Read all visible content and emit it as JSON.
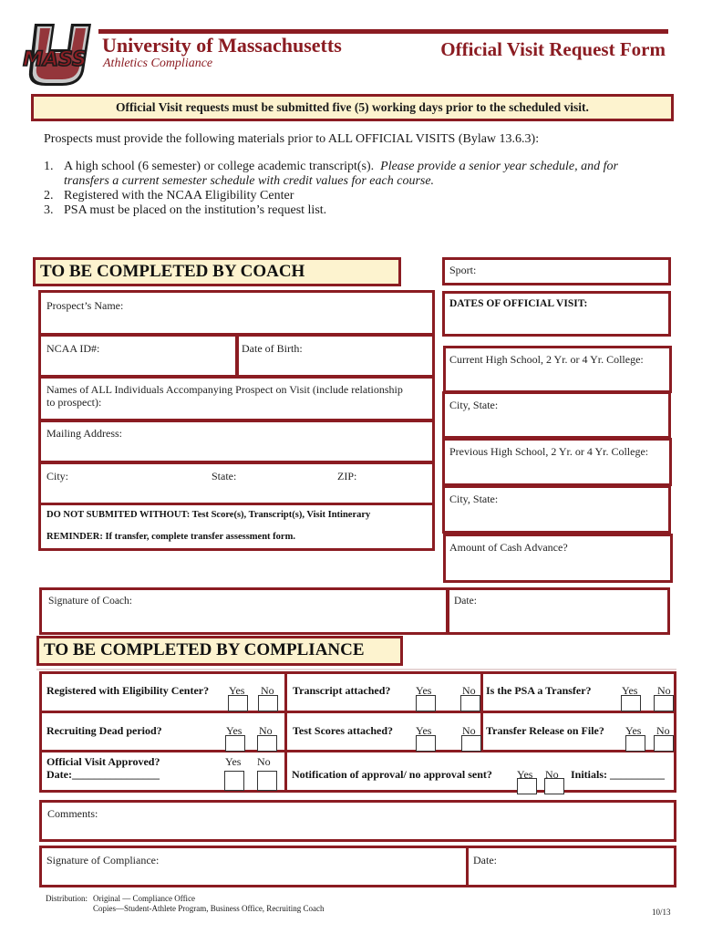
{
  "header": {
    "logo_text": "MASS",
    "logo_letter": "U",
    "university": "University of Massachusetts",
    "department": "Athletics Compliance",
    "form_title": "Official Visit Request Form"
  },
  "notice": "Official Visit requests must be submitted five (5) working days prior to the scheduled visit.",
  "requirements": {
    "intro": "Prospects must provide the following materials prior to ALL OFFICIAL VISITS (Bylaw 13.6.3):",
    "items": [
      {
        "num": "1.",
        "text": "A high school (6 semester) or college academic transcript(s).",
        "italic": "Please provide a senior year schedule, and for",
        "italic2": "transfers a current semester schedule with credit values for each course."
      },
      {
        "num": "2.",
        "text": "Registered with the NCAA Eligibility Center"
      },
      {
        "num": "3.",
        "text": "PSA must be placed on the institution’s request list."
      }
    ]
  },
  "coach_section": {
    "heading": "TO BE COMPLETED BY COACH",
    "fields": {
      "sport": "Sport:",
      "dates_of_visit": "DATES OF OFFICIAL VISIT:",
      "prospect_name": "Prospect’s Name:",
      "ncaa_id": "NCAA ID#:",
      "date_of_birth": "Date of Birth:",
      "current_school": "Current High School, 2 Yr. or 4 Yr. College:",
      "accompanying": "Names of ALL Individuals Accompanying Prospect on Visit (include relationship",
      "accompanying2": "to prospect):",
      "city_state_1": "City, State:",
      "mailing_address": "Mailing Address:",
      "previous_school": "Previous High School, 2 Yr. or 4 Yr. College:",
      "city": "City:",
      "state": "State:",
      "zip": "ZIP:",
      "city_state_2": "City, State:",
      "do_not_submit": "DO NOT SUBMITED WITHOUT: Test Score(s), Transcript(s), Visit Intinerary",
      "reminder": "REMINDER: If transfer, complete transfer assessment form.",
      "cash_advance": "Amount of Cash Advance?",
      "signature_coach": "Signature of Coach:",
      "date": "Date:"
    }
  },
  "compliance_section": {
    "heading": "TO BE COMPLETED BY COMPLIANCE",
    "yes": "Yes",
    "no": "No",
    "questions": {
      "registered": "Registered with Eligibility Center?",
      "transcript": "Transcript attached?",
      "psa_transfer": "Is the PSA a Transfer?",
      "dead_period": "Recruiting Dead period?",
      "test_scores": "Test Scores attached?",
      "transfer_release": "Transfer Release on File?",
      "visit_approved": "Official Visit Approved?",
      "approved_date": "Date:________________",
      "notification": "Notification of approval/ no approval sent?",
      "initials": "Initials: __________"
    },
    "comments": "Comments:",
    "signature_compliance": "Signature of Compliance:",
    "date": "Date:"
  },
  "footer": {
    "distribution_label": "Distribution:",
    "original": "Original — Compliance Office",
    "copies": "Copies—Student-Athlete Program, Business Office,  Recruiting Coach",
    "version": "10/13"
  }
}
